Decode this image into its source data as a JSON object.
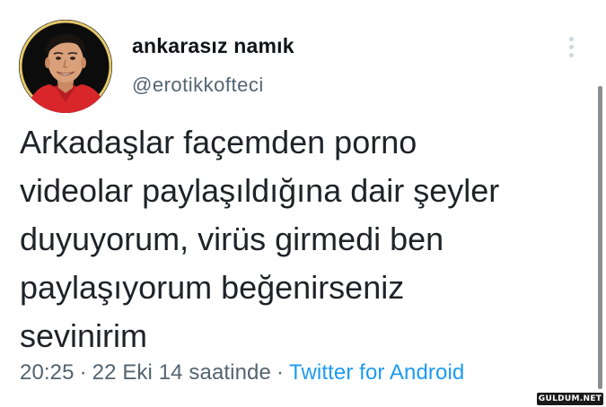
{
  "author": {
    "display_name": "ankarasız namık",
    "handle": "@erotikkofteci",
    "avatar_description": "profile photo of smiling man in red shirt"
  },
  "tweet": {
    "text_lines": [
      "Arkadaşlar façemden porno",
      "videolar paylaşıldığına dair şeyler",
      "duyuyorum, virüs girmedi ben",
      "paylaşıyorum beğenirseniz",
      "sevinirim"
    ],
    "time": "20:25",
    "date": "22 Eki 14 saatinde",
    "separator": "·",
    "source": "Twitter for Android"
  },
  "watermark": {
    "text": "GULDUM.NET"
  },
  "colors": {
    "text_primary": "#0f1419",
    "text_secondary": "#536471",
    "link": "#1d9bf0",
    "avatar_shirt": "#d8262a"
  },
  "icons": {
    "more": "more-vertical-icon"
  }
}
